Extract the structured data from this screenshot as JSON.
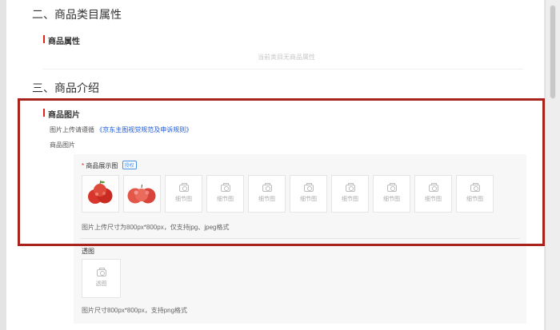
{
  "sections": {
    "category_attrs": {
      "title": "二、商品类目属性",
      "sub_title": "商品属性",
      "empty_text": "当前类目无商品属性"
    },
    "intro": {
      "title": "三、商品介绍",
      "sub_title": "商品图片",
      "hint_prefix": "图片上传请遵循",
      "rules_link": "《京东主图视觉规范及申诉规则》",
      "field_label": "商品图片"
    }
  },
  "main_images": {
    "required_mark": "*",
    "label": "商品展示图",
    "tag": "授权",
    "slots": [
      {
        "type": "image",
        "icon": "apple-photo"
      },
      {
        "type": "image",
        "icon": "apple-photo"
      },
      {
        "type": "empty",
        "caption": "细节图"
      },
      {
        "type": "empty",
        "caption": "细节图"
      },
      {
        "type": "empty",
        "caption": "细节图"
      },
      {
        "type": "empty",
        "caption": "细节图"
      },
      {
        "type": "empty",
        "caption": "细节图"
      },
      {
        "type": "empty",
        "caption": "细节图"
      },
      {
        "type": "empty",
        "caption": "细节图"
      },
      {
        "type": "empty",
        "caption": "细节图"
      }
    ],
    "size_note": "图片上传尺寸为800px*800px，仅支持jpg、jpeg格式"
  },
  "transparent_image": {
    "label": "透图",
    "caption": "透图",
    "note": "图片尺寸800px*800px，支持png格式"
  },
  "colors": {
    "accent": "#e1251b",
    "link": "#1a58d8",
    "highlight": "#a8231c"
  }
}
